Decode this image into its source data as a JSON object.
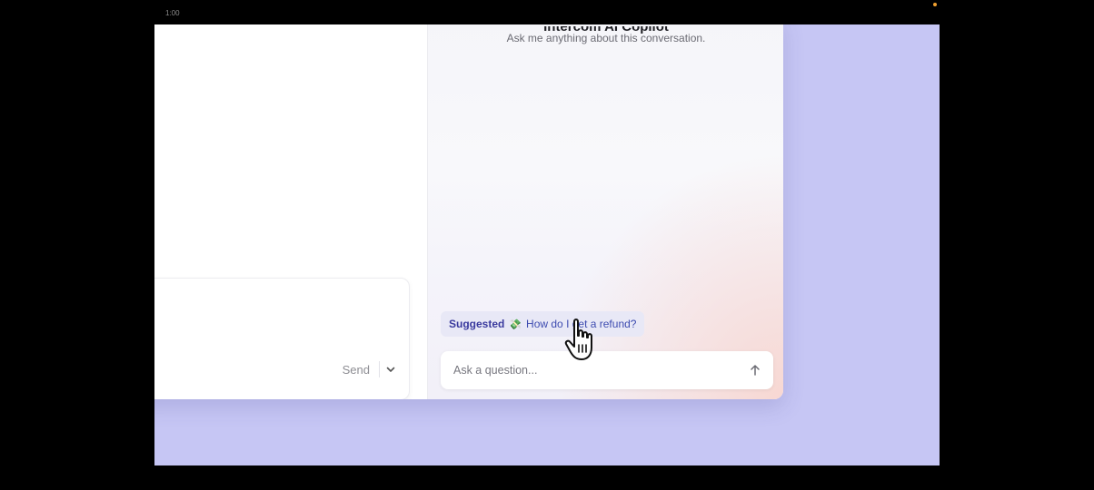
{
  "recording": {
    "timer": "1:00"
  },
  "composer": {
    "send_label": "Send",
    "dropdown_icon": "chevron-down-icon"
  },
  "copilot": {
    "title": "Intercom AI Copilot",
    "subtitle": "Ask me anything about this conversation.",
    "suggestion": {
      "label": "Suggested",
      "emoji": "💸",
      "text": "How do I get a refund?"
    },
    "input": {
      "placeholder": "Ask a question...",
      "value": ""
    },
    "send_icon": "arrow-up-icon"
  },
  "cursor_icon": "hand-pointer-icon",
  "colors": {
    "backdrop": "#c6c6f4",
    "accent": "#3d4bb0",
    "recording_dot": "#f0a030"
  }
}
